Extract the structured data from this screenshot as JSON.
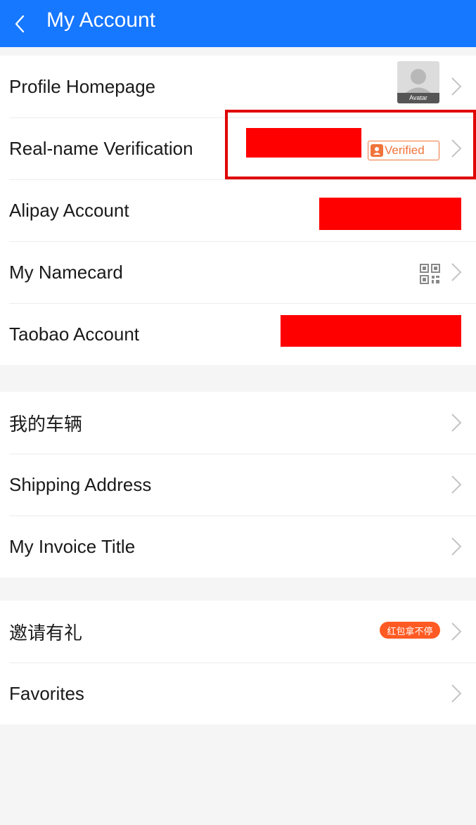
{
  "header": {
    "title": "My Account",
    "back_icon": "chevron-left-icon",
    "color": "#1677ff"
  },
  "account_section": {
    "profile_label": "Profile Homepage",
    "avatar_label": "Avatar",
    "realname_label": "Real-name Verification",
    "verified_badge": "Verified",
    "alipay_label": "Alipay Account",
    "namecard_label": "My Namecard",
    "taobao_label": "Taobao Account"
  },
  "vehicle_section": {
    "vehicle_label": "我的车辆",
    "shipping_label": "Shipping Address",
    "invoice_label": "My Invoice Title"
  },
  "invite_section": {
    "invite_label": "邀请有礼",
    "invite_badge": "红包拿不停",
    "favorites_label": "Favorites"
  },
  "colors": {
    "accent": "#1677ff",
    "verified_orange": "#f0743a",
    "promo_badge": "#ff5a23",
    "redaction": "#ff0000"
  }
}
